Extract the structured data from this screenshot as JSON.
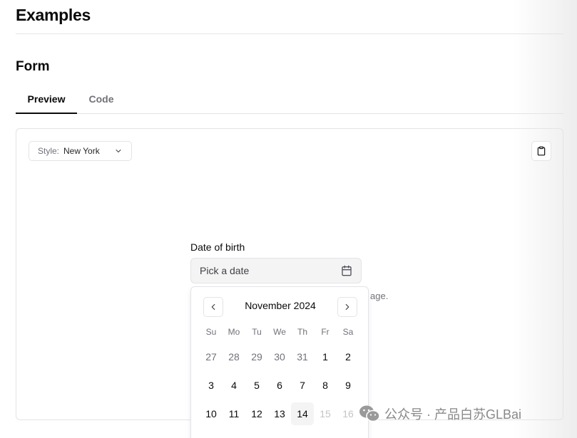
{
  "page": {
    "title": "Examples"
  },
  "section": {
    "title": "Form"
  },
  "tabs": [
    {
      "label": "Preview",
      "active": true
    },
    {
      "label": "Code",
      "active": false
    }
  ],
  "style_select": {
    "label": "Style:",
    "value": "New York"
  },
  "form": {
    "field_label": "Date of birth",
    "placeholder": "Pick a date",
    "description_fragment": "age."
  },
  "calendar": {
    "month": "November 2024",
    "weekdays": [
      "Su",
      "Mo",
      "Tu",
      "We",
      "Th",
      "Fr",
      "Sa"
    ],
    "days": [
      {
        "label": "27",
        "state": "outside"
      },
      {
        "label": "28",
        "state": "outside"
      },
      {
        "label": "29",
        "state": "outside"
      },
      {
        "label": "30",
        "state": "outside"
      },
      {
        "label": "31",
        "state": "outside"
      },
      {
        "label": "1",
        "state": "normal"
      },
      {
        "label": "2",
        "state": "normal"
      },
      {
        "label": "3",
        "state": "normal"
      },
      {
        "label": "4",
        "state": "normal"
      },
      {
        "label": "5",
        "state": "normal"
      },
      {
        "label": "6",
        "state": "normal"
      },
      {
        "label": "7",
        "state": "normal"
      },
      {
        "label": "8",
        "state": "normal"
      },
      {
        "label": "9",
        "state": "normal"
      },
      {
        "label": "10",
        "state": "normal"
      },
      {
        "label": "11",
        "state": "normal"
      },
      {
        "label": "12",
        "state": "normal"
      },
      {
        "label": "13",
        "state": "normal"
      },
      {
        "label": "14",
        "state": "today"
      },
      {
        "label": "15",
        "state": "disabled"
      },
      {
        "label": "16",
        "state": "disabled"
      }
    ]
  },
  "watermark": {
    "text": "公众号 · 产品白苏GLBai"
  },
  "icons": {
    "style_select": "chevron-down-icon",
    "copy": "clipboard-icon",
    "date_input": "calendar-icon",
    "prev": "chevron-left-icon",
    "next": "chevron-right-icon",
    "watermark": "wechat-icon"
  },
  "colors": {
    "text": "#0a0a0a",
    "muted": "#71717a",
    "border": "#e4e4e7",
    "input_bg": "#f4f4f5",
    "disabled": "#c4c4c8"
  }
}
